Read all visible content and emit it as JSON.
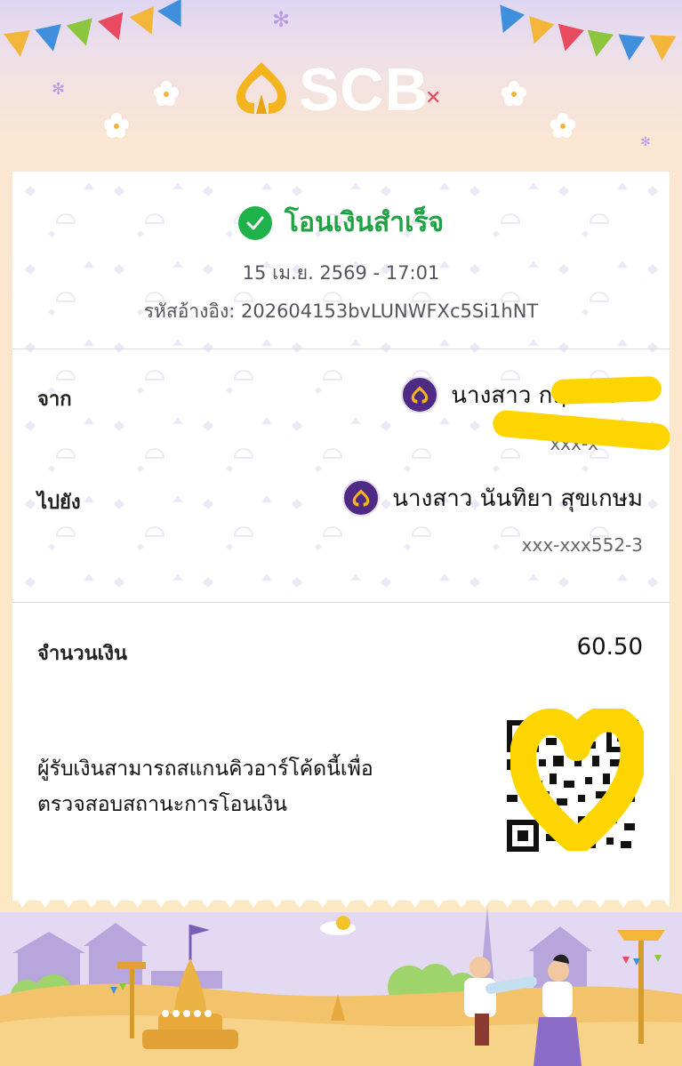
{
  "brand": {
    "name": "SCB",
    "color": "#4e2a84"
  },
  "status": {
    "text": "โอนเงินสำเร็จ",
    "color": "#1fa244",
    "icon": "check-circle-icon"
  },
  "date": "15 เม.ย. 2569 - 17:01",
  "reference": "รหัสอ้างอิง: 202604153bvLUNWFXc5Si1hNT",
  "from": {
    "label": "จาก",
    "name": "นางสาว กฤษณา",
    "account": "xxx-x",
    "bank_icon": "scb-logo-icon"
  },
  "to": {
    "label": "ไปยัง",
    "name": "นางสาว นันทิยา สุขเกษม",
    "account": "xxx-xxx552-3",
    "bank_icon": "scb-logo-icon"
  },
  "amount": {
    "label": "จำนวนเงิน",
    "value": "60.50"
  },
  "qr": {
    "note_line1": "ผู้รับเงินสามารถสแกนคิวอาร์โค้ดนี้เพื่อ",
    "note_line2": "ตรวจสอบสถานะการโอนเงิน",
    "icon": "qr-code-icon"
  },
  "decorations": {
    "highlight_color": "#ffd500"
  }
}
